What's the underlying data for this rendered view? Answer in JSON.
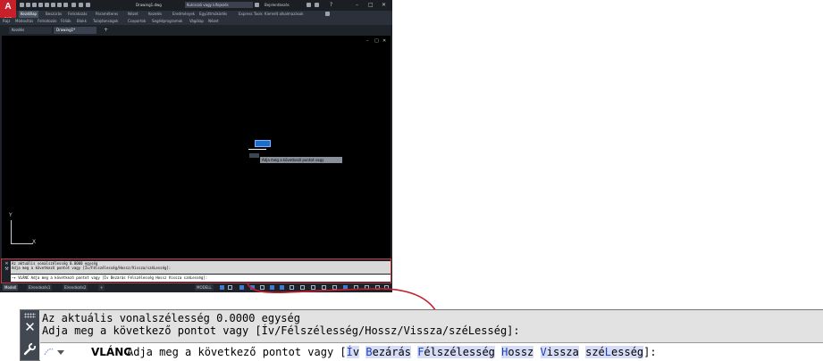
{
  "app": {
    "logo_letter": "A",
    "logo_sub": "CAD",
    "title": "Drawing1.dwg",
    "search_placeholder": "Kulcsszó vagy kifejezés",
    "user": "Bejelentkezés",
    "help": "?",
    "window_controls": [
      "–",
      "□",
      "✕"
    ]
  },
  "menu": {
    "tabs": [
      "Kezdőlap",
      "Beszúrás",
      "Feliratozás",
      "Paraméteres",
      "Nézet",
      "Kezelés",
      "Eredmények",
      "Együttműködés",
      "Express Tools",
      "Kiemelt alkalmazások"
    ],
    "active": "Kezdőlap"
  },
  "ribbon": {
    "panels": [
      "Rajz",
      "Módosítás",
      "Feliratozás",
      "Fóliák",
      "Blokk",
      "Tulajdonságok",
      "Csoportok",
      "Segédprogramok",
      "Vágólap",
      "Nézet"
    ]
  },
  "doc_tabs": {
    "items": [
      "Kezdés",
      "Drawing1*"
    ],
    "active": "Drawing1*",
    "add": "+"
  },
  "viewport": {
    "controls": [
      "–",
      "□",
      "✕"
    ],
    "dynamic_tooltip": "Adja meg a következő pontot vagy",
    "ucs_x": "X",
    "ucs_y": "Y"
  },
  "status_bar": {
    "tabs": [
      "Modell",
      "Elrendezés1",
      "Elrendezés2"
    ],
    "active": "Modell",
    "add": "+",
    "model_label": "MODELL"
  },
  "command_line": {
    "history": [
      "Az aktuális vonalszélesség 0.0000 egység",
      "Adja meg a következő pontot vagy [Ív/Félszélesség/Hossz/Vissza/széLesség]:"
    ],
    "command_name": "VLÁNC",
    "prompt": "Adja meg a következő pontot vagy",
    "open_bracket": "[",
    "close_bracket": "]:",
    "options": [
      {
        "pre": "",
        "key": "Í",
        "post": "v"
      },
      {
        "pre": "",
        "key": "B",
        "post": "ezárás"
      },
      {
        "pre": "",
        "key": "F",
        "post": "élszélesség"
      },
      {
        "pre": "",
        "key": "H",
        "post": "ossz"
      },
      {
        "pre": "",
        "key": "V",
        "post": "issza"
      },
      {
        "pre": "szé",
        "key": "L",
        "post": "esség"
      }
    ],
    "small_line": "⋯▾ VLÁNC Adja meg a következő pontot vagy [Ív Bezárás Félszélesség Hossz Vissza széLesség]:"
  },
  "colors": {
    "app_bg": "#1e2329",
    "drawing_bg": "#000000",
    "highlight": "#c93a3a",
    "option_bg": "#d6dcf5",
    "option_key": "#1e3fb8"
  }
}
